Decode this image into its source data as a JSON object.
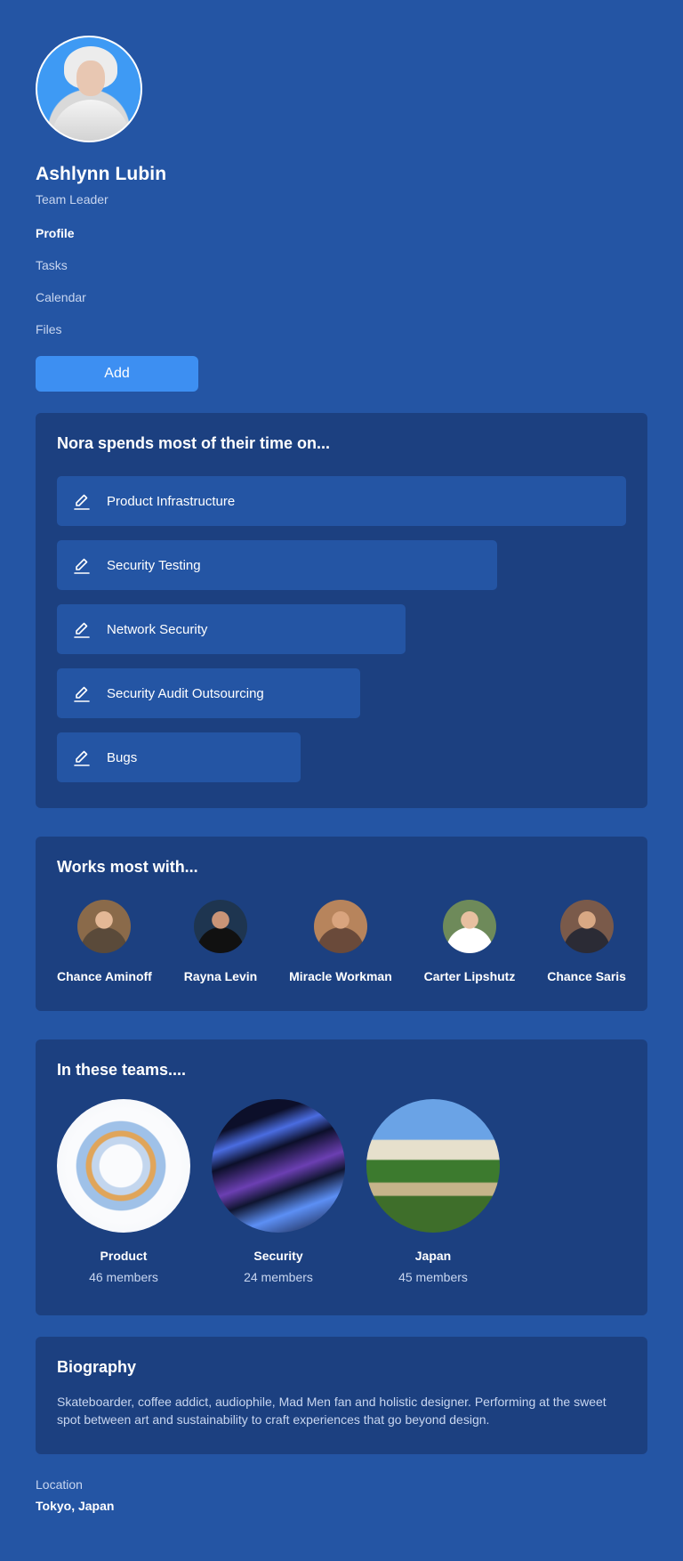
{
  "profile": {
    "name": "Ashlynn Lubin",
    "role": "Team Leader"
  },
  "nav": {
    "items": [
      {
        "label": "Profile",
        "active": true
      },
      {
        "label": "Tasks",
        "active": false
      },
      {
        "label": "Calendar",
        "active": false
      },
      {
        "label": "Files",
        "active": false
      }
    ]
  },
  "add_button": {
    "label": "Add"
  },
  "time_card": {
    "title": "Nora spends most of their time on...",
    "items": [
      {
        "label": "Product Infrastructure",
        "share": 1.0,
        "icon": "pencil-icon"
      },
      {
        "label": "Security Testing",
        "share": 0.7742,
        "icon": "pencil-icon"
      },
      {
        "label": "Network Security",
        "share": 0.6129,
        "icon": "pencil-icon"
      },
      {
        "label": "Security Audit Outsourcing",
        "share": 0.5323,
        "icon": "pencil-icon"
      },
      {
        "label": "Bugs",
        "share": 0.4274,
        "icon": "pencil-icon"
      }
    ]
  },
  "works_with": {
    "title": "Works most with...",
    "people": [
      {
        "name": "Chance Aminoff"
      },
      {
        "name": "Rayna Levin"
      },
      {
        "name": "Miracle Workman"
      },
      {
        "name": "Carter Lipshutz"
      },
      {
        "name": "Chance Saris"
      }
    ]
  },
  "teams": {
    "title": "In these teams....",
    "items": [
      {
        "name": "Product",
        "members": "46 members"
      },
      {
        "name": "Security",
        "members": "24 members"
      },
      {
        "name": "Japan",
        "members": "45 members"
      }
    ]
  },
  "biography": {
    "title": "Biography",
    "text": "Skateboarder, coffee addict, audiophile, Mad Men fan and holistic designer. Performing at the sweet spot between art and sustainability to craft experiences that go beyond design."
  },
  "location": {
    "label": "Location",
    "value": "Tokyo, Japan"
  },
  "colors": {
    "background": "#2455a4",
    "card": "#1c4080",
    "bar": "#2455a4",
    "accent_button": "#3d8ff2",
    "muted_text": "#c8d6f0"
  }
}
